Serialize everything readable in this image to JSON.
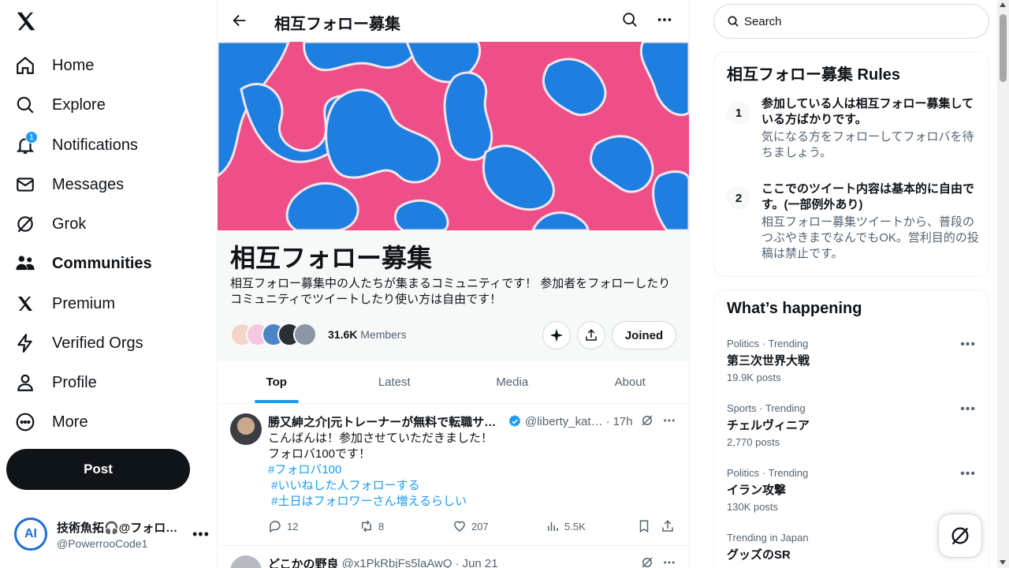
{
  "nav": {
    "items": [
      {
        "label": "Home",
        "icon": "home-icon"
      },
      {
        "label": "Explore",
        "icon": "search-icon"
      },
      {
        "label": "Notifications",
        "icon": "bell-icon",
        "badge": "1"
      },
      {
        "label": "Messages",
        "icon": "mail-icon"
      },
      {
        "label": "Grok",
        "icon": "grok-icon"
      },
      {
        "label": "Communities",
        "icon": "communities-icon",
        "active": true
      },
      {
        "label": "Premium",
        "icon": "x-logo-icon"
      },
      {
        "label": "Verified Orgs",
        "icon": "lightning-icon"
      },
      {
        "label": "Profile",
        "icon": "person-icon"
      },
      {
        "label": "More",
        "icon": "more-circle-icon"
      }
    ],
    "post_label": "Post",
    "account": {
      "name": "技術魚拓🎧@フォロ…",
      "handle": "@PowerrooCode1",
      "avatar_text": "AI"
    }
  },
  "community": {
    "header_title": "相互フォロー募集",
    "name": "相互フォロー募集",
    "description": "相互フォロー募集中の人たちが集まるコミュニティです！ 参加者をフォローしたりコミュニティでツイートしたり使い方は自由です！",
    "members_count": "31.6K",
    "members_label": "Members",
    "joined_label": "Joined",
    "tabs": [
      "Top",
      "Latest",
      "Media",
      "About"
    ],
    "active_tab": "Top"
  },
  "tweets": [
    {
      "name": "勝又紳之介|元トレーナーが無料で転職サポ…",
      "handle": "@liberty_kat…",
      "time": "17h",
      "lines": [
        "こんばんは！参加させていただきました！",
        "フォロバ100です！"
      ],
      "hashtags": [
        "#フォロバ100",
        " #いいねした人フォローする",
        " #土日はフォロワーさん増えるらしい"
      ],
      "replies": "12",
      "retweets": "8",
      "likes": "207",
      "views": "5.5K"
    },
    {
      "name": "どこかの野良",
      "handle": "@x1PkRbjFs5laAwQ",
      "time": "Jun 21"
    }
  ],
  "right": {
    "search_placeholder": "Search",
    "rules_title": "相互フォロー募集 Rules",
    "rules": [
      {
        "num": "1",
        "title": "参加している人は相互フォロー募集している方ばかりです。",
        "desc": "気になる方をフォローしてフォロバを待ちましょう。"
      },
      {
        "num": "2",
        "title": "ここでのツイート内容は基本的に自由です。(一部例外あり)",
        "desc": "相互フォロー募集ツイートから、普段のつぶやきまでなんでもOK。営利目的の投稿は禁止です。"
      }
    ],
    "happening_title": "What’s happening",
    "trends": [
      {
        "context": "Politics · Trending",
        "name": "第三次世界大戦",
        "count": "19.9K posts"
      },
      {
        "context": "Sports · Trending",
        "name": "チェルヴィニア",
        "count": "2,770 posts"
      },
      {
        "context": "Politics · Trending",
        "name": "イラン攻撃",
        "count": "130K posts"
      },
      {
        "context": "Trending in Japan",
        "name": "グッズのSR",
        "count": ""
      }
    ]
  },
  "colors": {
    "accent": "#1d9bf0",
    "text": "#0f1419",
    "muted": "#536471",
    "banner_pink": "#ee4f86",
    "banner_blue": "#1f7fe0"
  }
}
